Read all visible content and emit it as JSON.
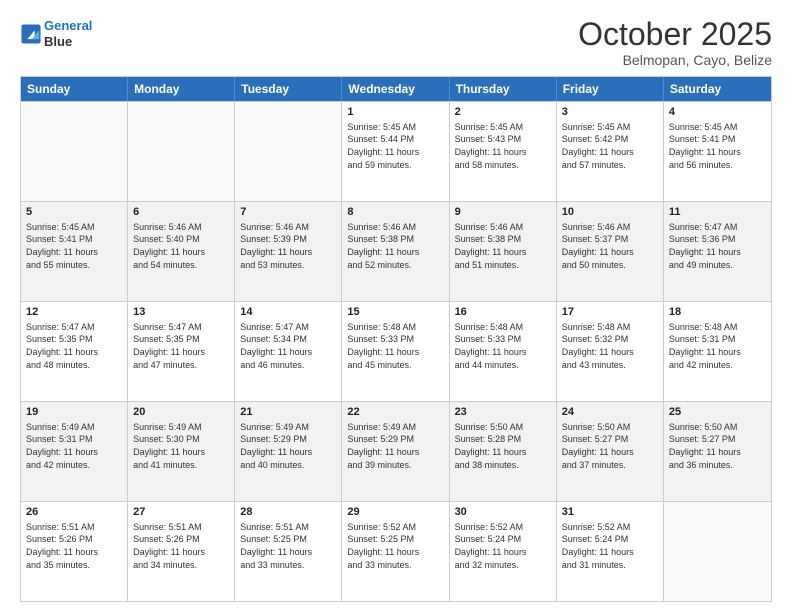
{
  "header": {
    "logo_line1": "General",
    "logo_line2": "Blue",
    "month_title": "October 2025",
    "location": "Belmopan, Cayo, Belize"
  },
  "weekdays": [
    "Sunday",
    "Monday",
    "Tuesday",
    "Wednesday",
    "Thursday",
    "Friday",
    "Saturday"
  ],
  "rows": [
    [
      {
        "day": "",
        "info": "",
        "empty": true
      },
      {
        "day": "",
        "info": "",
        "empty": true
      },
      {
        "day": "",
        "info": "",
        "empty": true
      },
      {
        "day": "1",
        "info": "Sunrise: 5:45 AM\nSunset: 5:44 PM\nDaylight: 11 hours\nand 59 minutes.",
        "empty": false
      },
      {
        "day": "2",
        "info": "Sunrise: 5:45 AM\nSunset: 5:43 PM\nDaylight: 11 hours\nand 58 minutes.",
        "empty": false
      },
      {
        "day": "3",
        "info": "Sunrise: 5:45 AM\nSunset: 5:42 PM\nDaylight: 11 hours\nand 57 minutes.",
        "empty": false
      },
      {
        "day": "4",
        "info": "Sunrise: 5:45 AM\nSunset: 5:41 PM\nDaylight: 11 hours\nand 56 minutes.",
        "empty": false
      }
    ],
    [
      {
        "day": "5",
        "info": "Sunrise: 5:45 AM\nSunset: 5:41 PM\nDaylight: 11 hours\nand 55 minutes.",
        "empty": false,
        "shaded": true
      },
      {
        "day": "6",
        "info": "Sunrise: 5:46 AM\nSunset: 5:40 PM\nDaylight: 11 hours\nand 54 minutes.",
        "empty": false,
        "shaded": true
      },
      {
        "day": "7",
        "info": "Sunrise: 5:46 AM\nSunset: 5:39 PM\nDaylight: 11 hours\nand 53 minutes.",
        "empty": false,
        "shaded": true
      },
      {
        "day": "8",
        "info": "Sunrise: 5:46 AM\nSunset: 5:38 PM\nDaylight: 11 hours\nand 52 minutes.",
        "empty": false,
        "shaded": true
      },
      {
        "day": "9",
        "info": "Sunrise: 5:46 AM\nSunset: 5:38 PM\nDaylight: 11 hours\nand 51 minutes.",
        "empty": false,
        "shaded": true
      },
      {
        "day": "10",
        "info": "Sunrise: 5:46 AM\nSunset: 5:37 PM\nDaylight: 11 hours\nand 50 minutes.",
        "empty": false,
        "shaded": true
      },
      {
        "day": "11",
        "info": "Sunrise: 5:47 AM\nSunset: 5:36 PM\nDaylight: 11 hours\nand 49 minutes.",
        "empty": false,
        "shaded": true
      }
    ],
    [
      {
        "day": "12",
        "info": "Sunrise: 5:47 AM\nSunset: 5:35 PM\nDaylight: 11 hours\nand 48 minutes.",
        "empty": false
      },
      {
        "day": "13",
        "info": "Sunrise: 5:47 AM\nSunset: 5:35 PM\nDaylight: 11 hours\nand 47 minutes.",
        "empty": false
      },
      {
        "day": "14",
        "info": "Sunrise: 5:47 AM\nSunset: 5:34 PM\nDaylight: 11 hours\nand 46 minutes.",
        "empty": false
      },
      {
        "day": "15",
        "info": "Sunrise: 5:48 AM\nSunset: 5:33 PM\nDaylight: 11 hours\nand 45 minutes.",
        "empty": false
      },
      {
        "day": "16",
        "info": "Sunrise: 5:48 AM\nSunset: 5:33 PM\nDaylight: 11 hours\nand 44 minutes.",
        "empty": false
      },
      {
        "day": "17",
        "info": "Sunrise: 5:48 AM\nSunset: 5:32 PM\nDaylight: 11 hours\nand 43 minutes.",
        "empty": false
      },
      {
        "day": "18",
        "info": "Sunrise: 5:48 AM\nSunset: 5:31 PM\nDaylight: 11 hours\nand 42 minutes.",
        "empty": false
      }
    ],
    [
      {
        "day": "19",
        "info": "Sunrise: 5:49 AM\nSunset: 5:31 PM\nDaylight: 11 hours\nand 42 minutes.",
        "empty": false,
        "shaded": true
      },
      {
        "day": "20",
        "info": "Sunrise: 5:49 AM\nSunset: 5:30 PM\nDaylight: 11 hours\nand 41 minutes.",
        "empty": false,
        "shaded": true
      },
      {
        "day": "21",
        "info": "Sunrise: 5:49 AM\nSunset: 5:29 PM\nDaylight: 11 hours\nand 40 minutes.",
        "empty": false,
        "shaded": true
      },
      {
        "day": "22",
        "info": "Sunrise: 5:49 AM\nSunset: 5:29 PM\nDaylight: 11 hours\nand 39 minutes.",
        "empty": false,
        "shaded": true
      },
      {
        "day": "23",
        "info": "Sunrise: 5:50 AM\nSunset: 5:28 PM\nDaylight: 11 hours\nand 38 minutes.",
        "empty": false,
        "shaded": true
      },
      {
        "day": "24",
        "info": "Sunrise: 5:50 AM\nSunset: 5:27 PM\nDaylight: 11 hours\nand 37 minutes.",
        "empty": false,
        "shaded": true
      },
      {
        "day": "25",
        "info": "Sunrise: 5:50 AM\nSunset: 5:27 PM\nDaylight: 11 hours\nand 36 minutes.",
        "empty": false,
        "shaded": true
      }
    ],
    [
      {
        "day": "26",
        "info": "Sunrise: 5:51 AM\nSunset: 5:26 PM\nDaylight: 11 hours\nand 35 minutes.",
        "empty": false
      },
      {
        "day": "27",
        "info": "Sunrise: 5:51 AM\nSunset: 5:26 PM\nDaylight: 11 hours\nand 34 minutes.",
        "empty": false
      },
      {
        "day": "28",
        "info": "Sunrise: 5:51 AM\nSunset: 5:25 PM\nDaylight: 11 hours\nand 33 minutes.",
        "empty": false
      },
      {
        "day": "29",
        "info": "Sunrise: 5:52 AM\nSunset: 5:25 PM\nDaylight: 11 hours\nand 33 minutes.",
        "empty": false
      },
      {
        "day": "30",
        "info": "Sunrise: 5:52 AM\nSunset: 5:24 PM\nDaylight: 11 hours\nand 32 minutes.",
        "empty": false
      },
      {
        "day": "31",
        "info": "Sunrise: 5:52 AM\nSunset: 5:24 PM\nDaylight: 11 hours\nand 31 minutes.",
        "empty": false
      },
      {
        "day": "",
        "info": "",
        "empty": true
      }
    ]
  ]
}
